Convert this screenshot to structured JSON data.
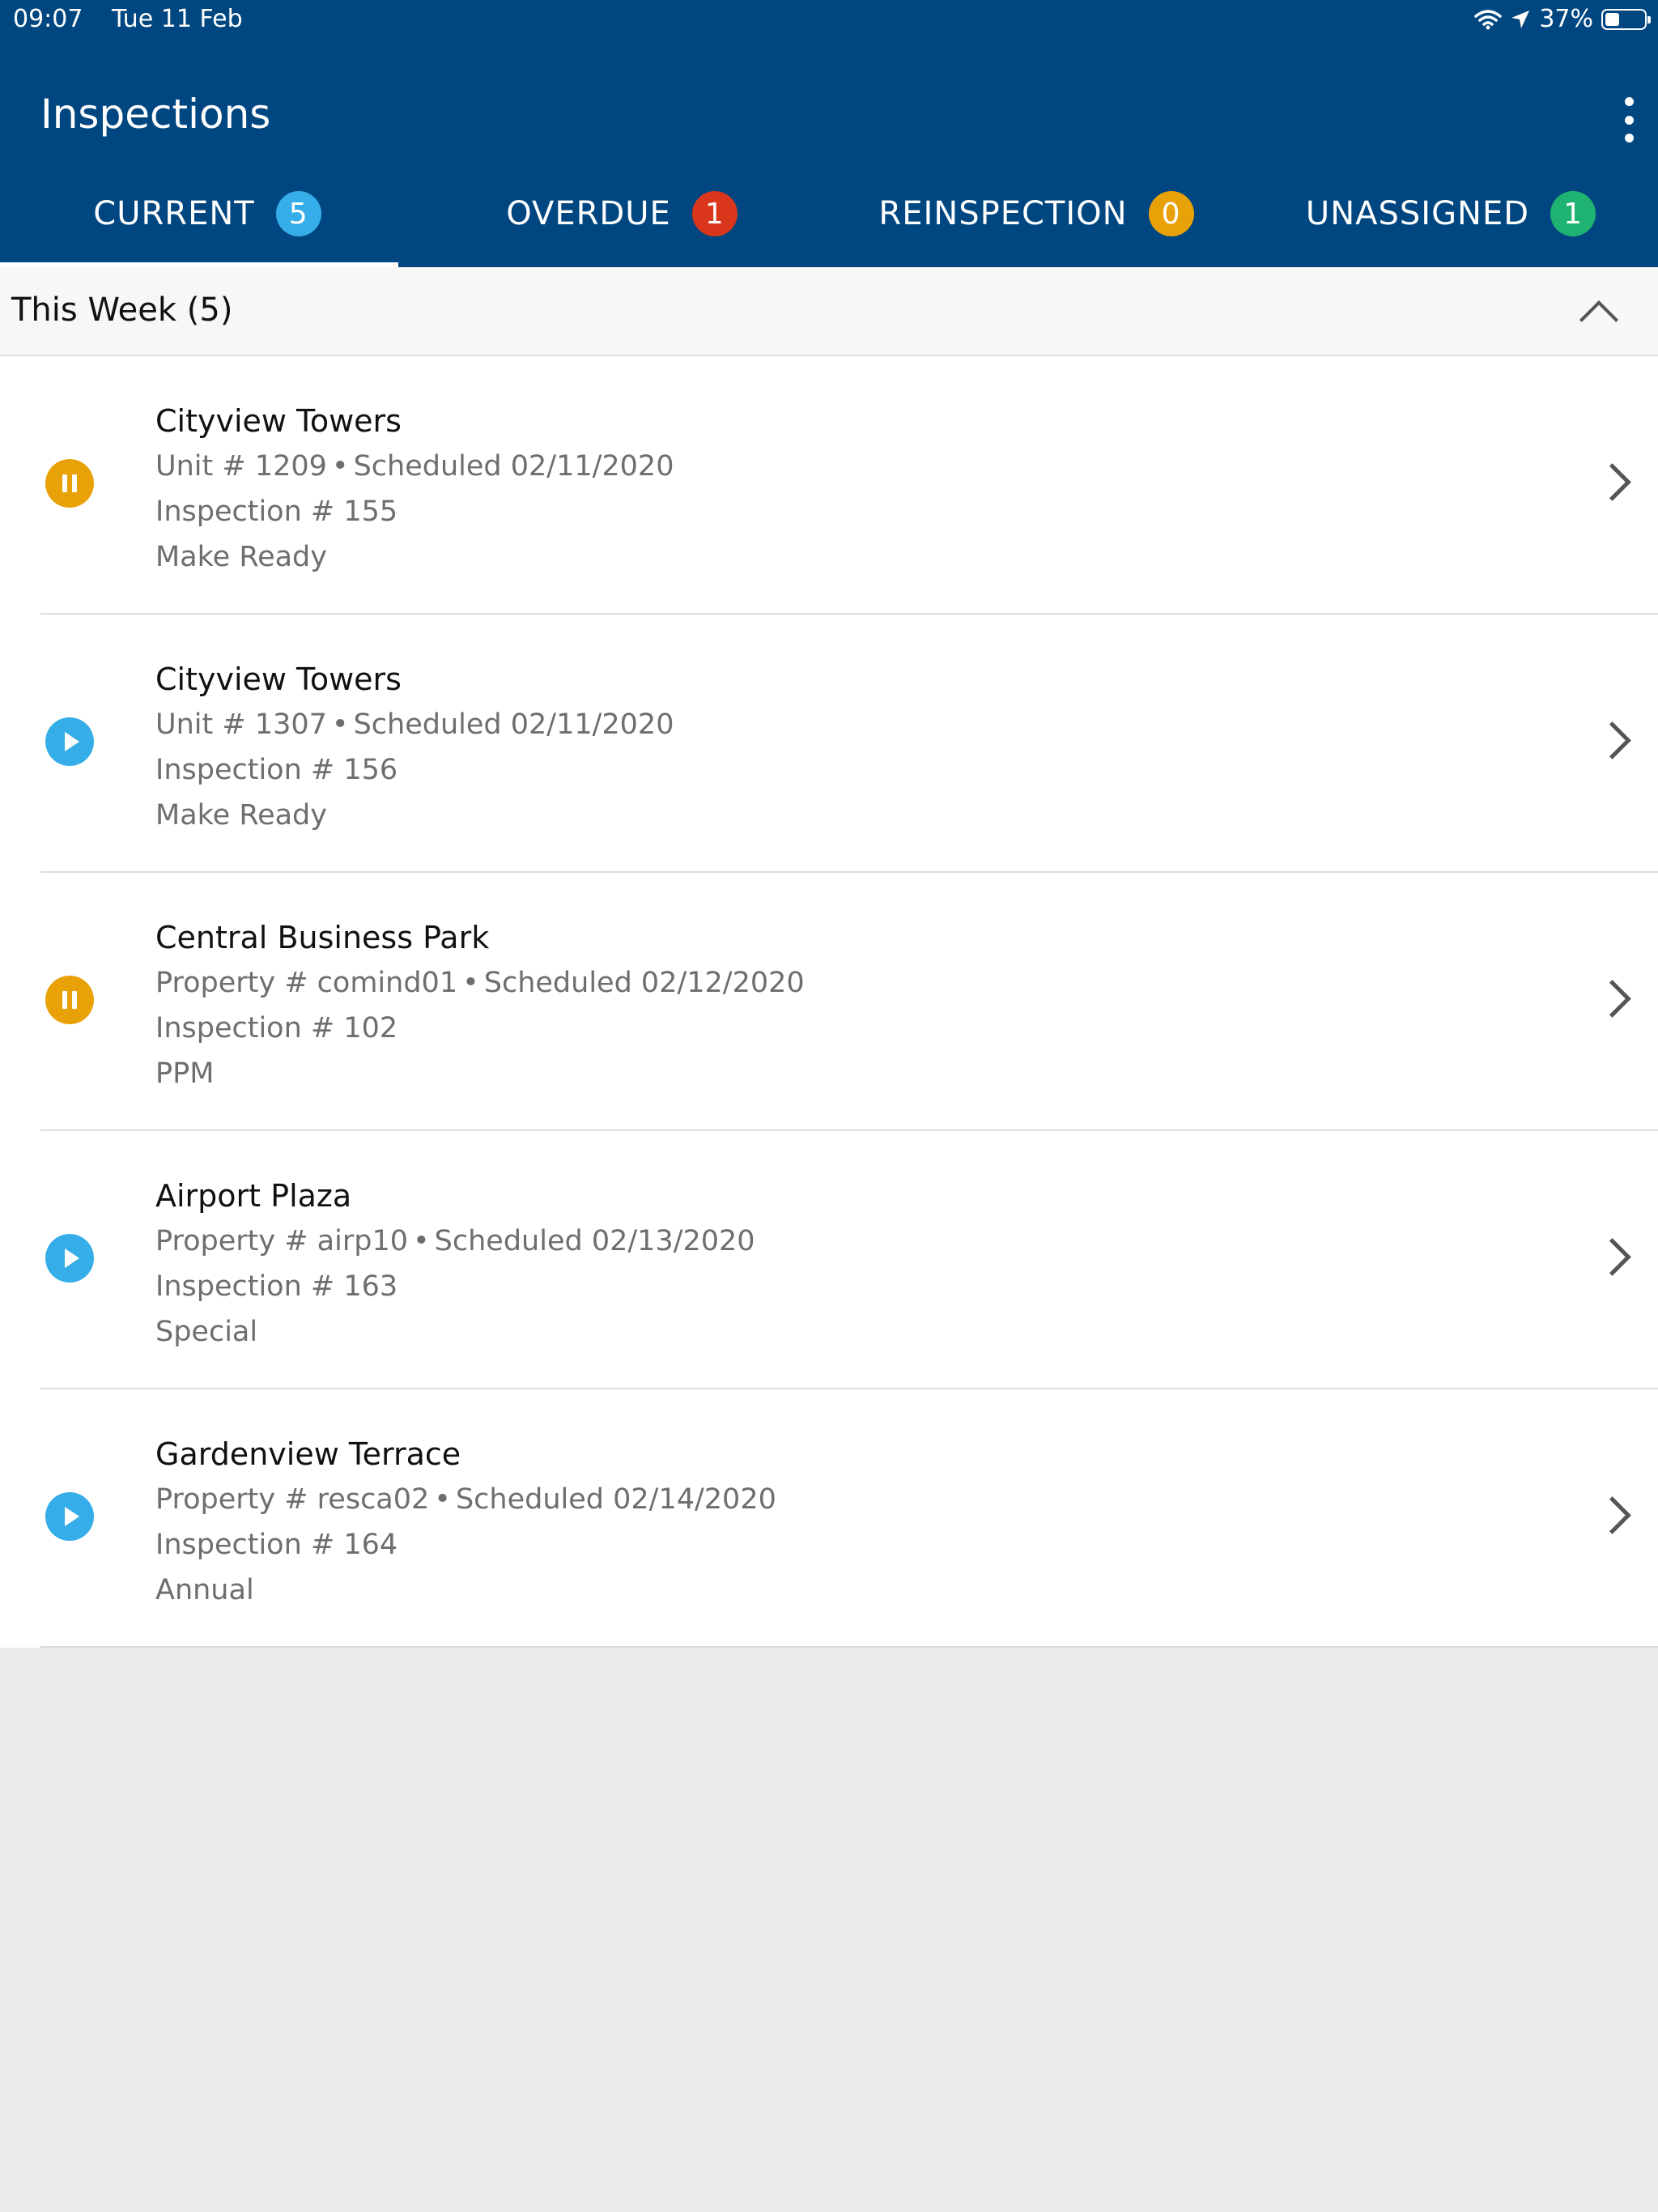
{
  "status_bar": {
    "time": "09:07",
    "date": "Tue 11 Feb",
    "battery": "37%"
  },
  "header": {
    "title": "Inspections"
  },
  "tabs": [
    {
      "label": "CURRENT",
      "count": "5",
      "color": "#35ade8"
    },
    {
      "label": "OVERDUE",
      "count": "1",
      "color": "#d9361b"
    },
    {
      "label": "REINSPECTION",
      "count": "0",
      "color": "#e8a207"
    },
    {
      "label": "UNASSIGNED",
      "count": "1",
      "color": "#1fb371"
    }
  ],
  "section": {
    "title": "This Week (5)"
  },
  "inspections": [
    {
      "status": "paused",
      "name": "Cityview Towers",
      "location": "Unit # 1209",
      "scheduled": "Scheduled 02/11/2020",
      "number": "Inspection # 155",
      "type": "Make Ready"
    },
    {
      "status": "play",
      "name": "Cityview Towers",
      "location": "Unit # 1307",
      "scheduled": "Scheduled 02/11/2020",
      "number": "Inspection # 156",
      "type": "Make Ready"
    },
    {
      "status": "paused",
      "name": "Central Business Park",
      "location": "Property # comind01",
      "scheduled": "Scheduled 02/12/2020",
      "number": "Inspection # 102",
      "type": "PPM"
    },
    {
      "status": "play",
      "name": "Airport Plaza",
      "location": "Property # airp10",
      "scheduled": "Scheduled 02/13/2020",
      "number": "Inspection # 163",
      "type": "Special"
    },
    {
      "status": "play",
      "name": "Gardenview Terrace",
      "location": "Property # resca02",
      "scheduled": "Scheduled 02/14/2020",
      "number": "Inspection # 164",
      "type": "Annual"
    }
  ]
}
